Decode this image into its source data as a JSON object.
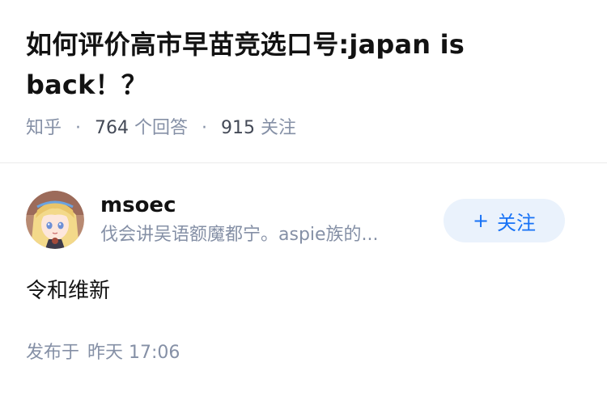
{
  "question": {
    "title": "如何评价高市早苗竞选口号:japan is back！？",
    "source": "知乎",
    "answers_count": "764",
    "answers_label": "个回答",
    "followers_count": "915",
    "followers_label": "关注"
  },
  "author": {
    "name": "msoec",
    "bio": "伐会讲吴语额魔都宁。aspie族的...",
    "avatar_icon": "anime-avatar",
    "follow_button_label": "关注",
    "follow_icon": "plus-icon"
  },
  "answer": {
    "content": "令和维新",
    "time_label": "发布于",
    "time_value": "昨天 17:06"
  },
  "colors": {
    "title": "#121212",
    "meta": "#8590a6",
    "accent": "#1772f6",
    "button_bg": "#eaf2fc"
  }
}
